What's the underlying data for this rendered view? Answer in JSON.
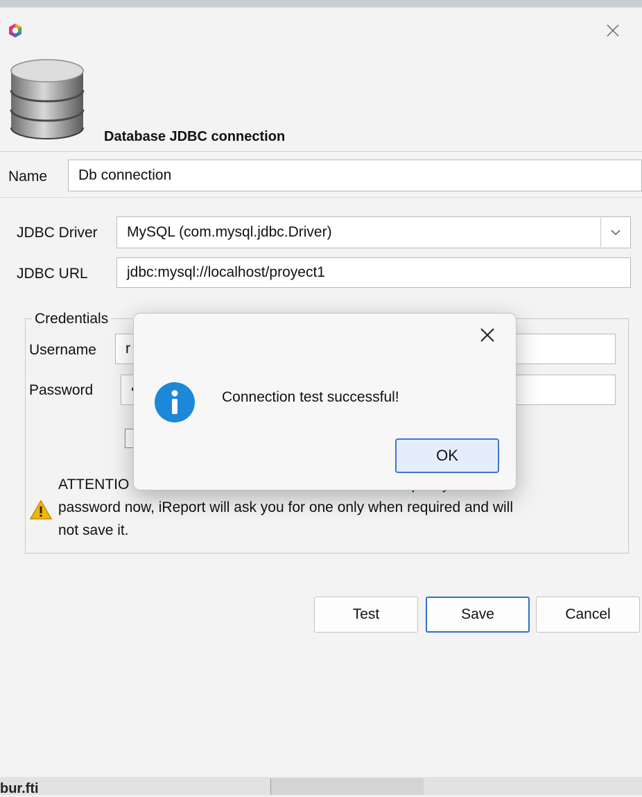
{
  "dialog": {
    "header_title": "Database JDBC connection",
    "name_label": "Name",
    "name_value": "Db connection",
    "driver_label": "JDBC Driver",
    "driver_value": "MySQL (com.mysql.jdbc.Driver)",
    "url_label": "JDBC URL",
    "url_value": "jdbc:mysql://localhost/proyect1",
    "credentials": {
      "legend": "Credentials",
      "username_label": "Username",
      "username_value": "r",
      "password_label": "Password",
      "password_value": "•",
      "attention_line1": "ATTENTIO                                                                    specify a",
      "attention_line2": "password now, iReport will ask you for one only when required and will",
      "attention_line3": "not save it."
    },
    "buttons": {
      "test": "Test",
      "save": "Save",
      "cancel": "Cancel"
    }
  },
  "message_box": {
    "text": "Connection test successful!",
    "ok": "OK",
    "icon": "info-icon"
  },
  "background_text": "bur.fti",
  "colors": {
    "accent": "#2f6fd0",
    "info": "#1e88d8",
    "warning": "#f2b705"
  }
}
